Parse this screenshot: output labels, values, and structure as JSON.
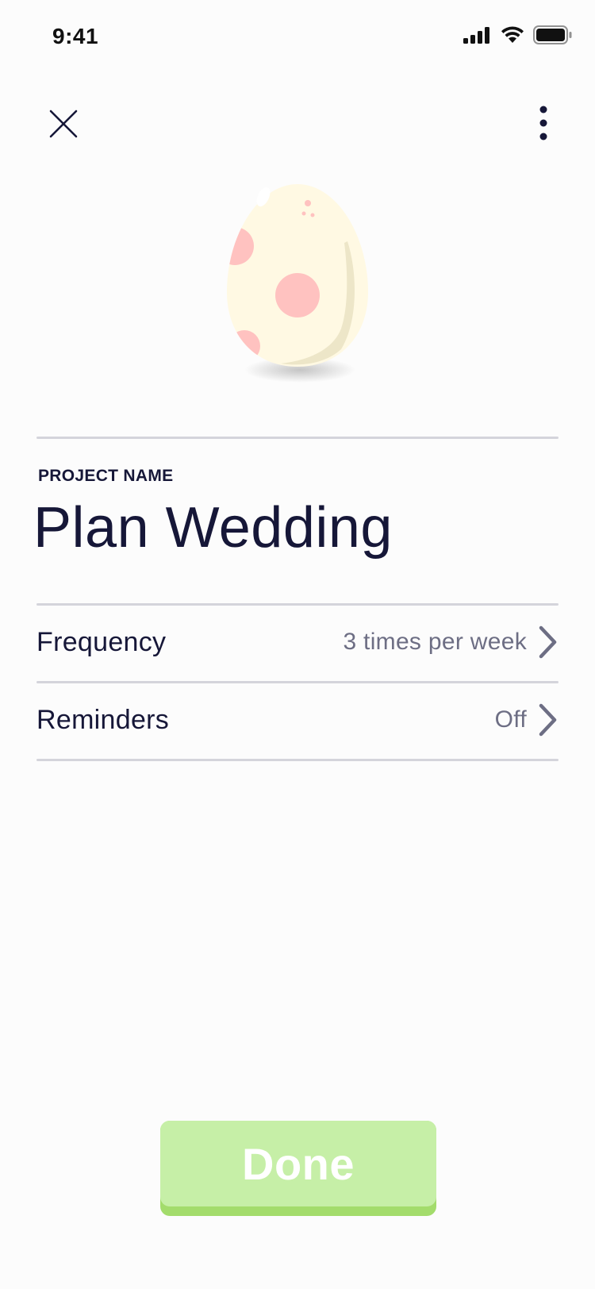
{
  "status_bar": {
    "time": "9:41"
  },
  "header": {
    "close_icon": "close-icon",
    "more_icon": "more-vertical-icon"
  },
  "project": {
    "label": "PROJECT NAME",
    "name": "Plan Wedding"
  },
  "settings": {
    "frequency": {
      "label": "Frequency",
      "value": "3 times per week"
    },
    "reminders": {
      "label": "Reminders",
      "value": "Off"
    }
  },
  "done_button": {
    "label": "Done"
  },
  "colors": {
    "text_primary": "#161738",
    "text_secondary": "#6d6e84",
    "divider": "#d4d4db",
    "done_face": "#c6efa7",
    "done_base": "#a3dc6c",
    "egg_shell": "#fff9e3",
    "egg_spot": "#ffc2c0"
  }
}
